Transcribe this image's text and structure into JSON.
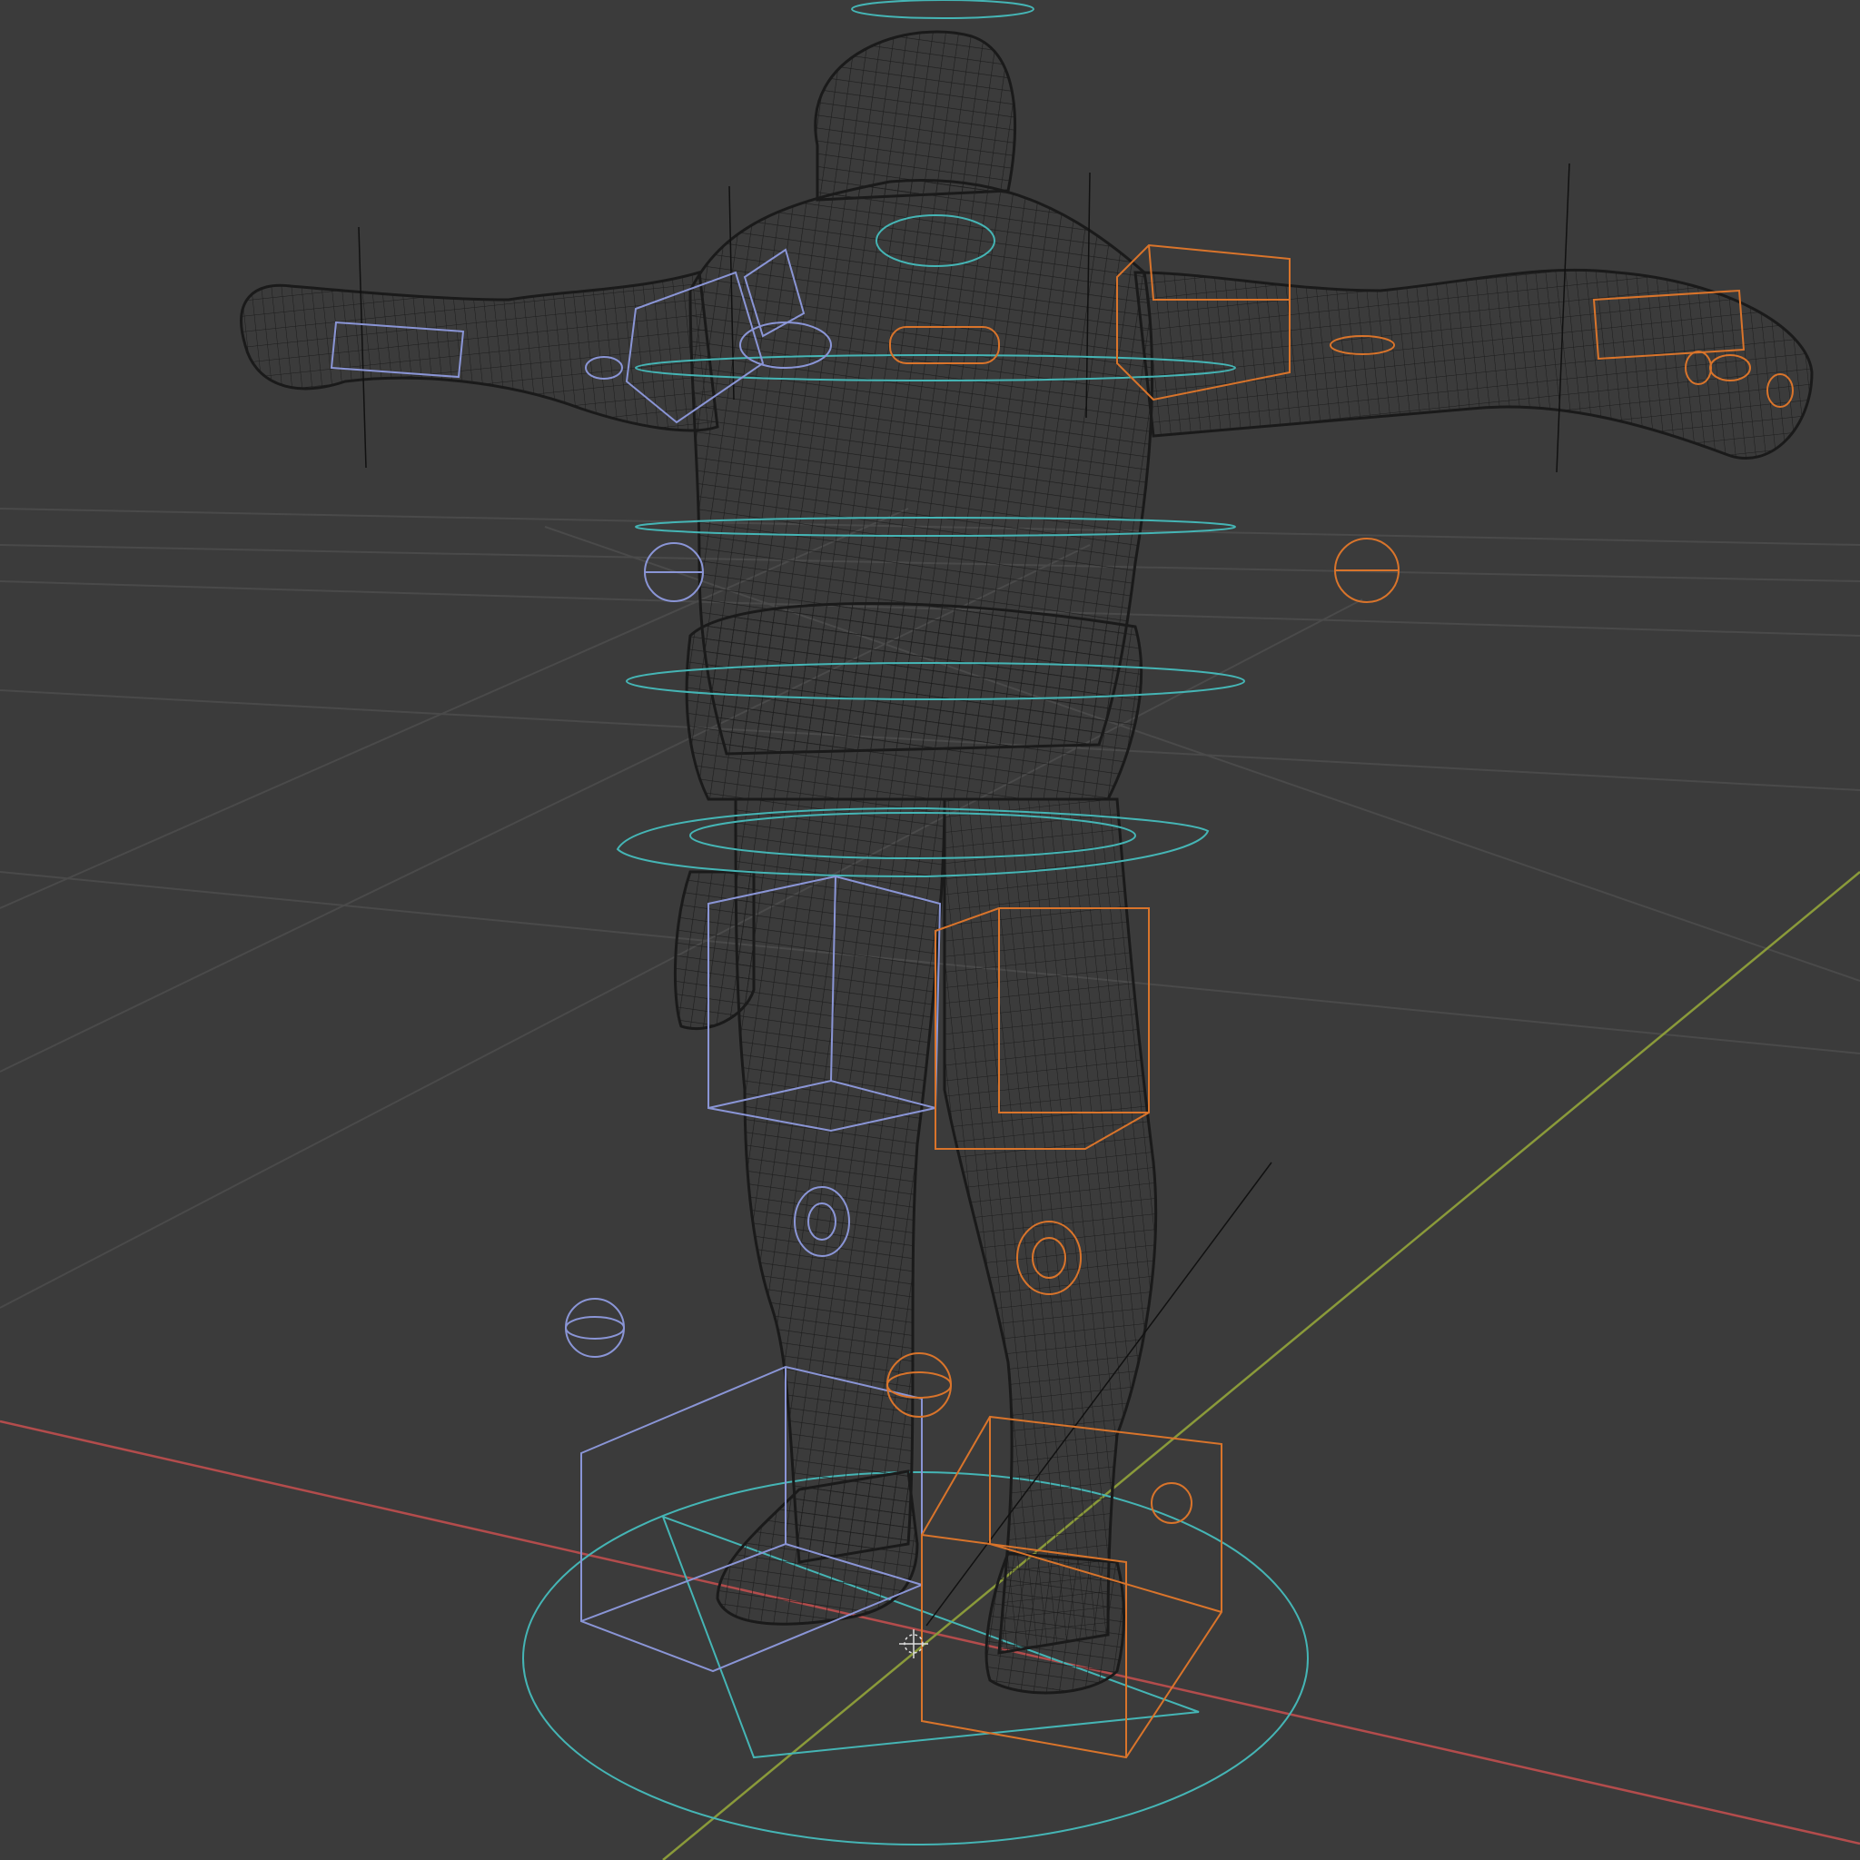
{
  "viewport": {
    "background": "#3b3b3b",
    "grid_color": "#4a4a4a",
    "axis_x_color": "#b34c4c",
    "axis_y_color": "#8a9a3a",
    "mesh_color": "#1e1e1e",
    "mesh_fill": "#454545",
    "ctrl_left_color": "#8a95d6",
    "ctrl_right_color": "#d9742b",
    "ctrl_center_color": "#45b5b5",
    "bone_line_color": "#111111"
  }
}
